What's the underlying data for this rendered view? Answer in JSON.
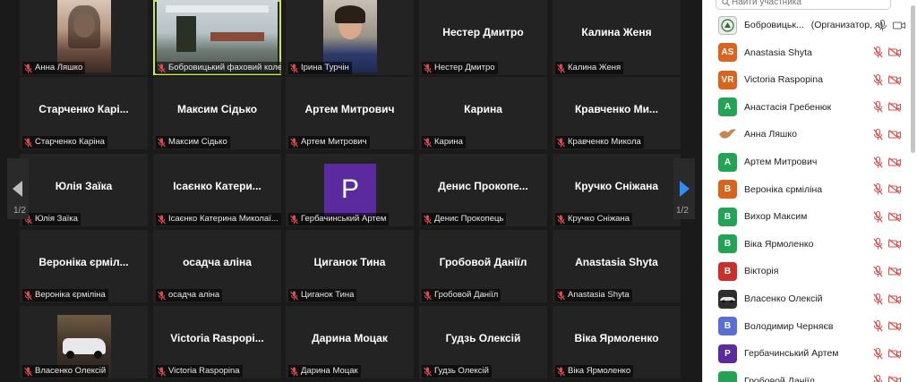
{
  "gallery": {
    "page_indicator": "1/2",
    "tiles": [
      {
        "label": "Анна Ляшко",
        "center": "",
        "kind": "photo-girl"
      },
      {
        "label": "Бобровицький фаховий коле...",
        "center": "",
        "kind": "photo-room",
        "active": true
      },
      {
        "label": "Ірина Турчін",
        "center": "",
        "kind": "photo-woman"
      },
      {
        "label": "Нестер Дмитро",
        "center": "Нестер Дмитро"
      },
      {
        "label": "Калина Женя",
        "center": "Калина Женя"
      },
      {
        "label": "Старченко Каріна",
        "center": "Старченко  Карі..."
      },
      {
        "label": "Максим Сідько",
        "center": "Максим Сідько"
      },
      {
        "label": "Артем Митрович",
        "center": "Артем Митрович"
      },
      {
        "label": "Карина",
        "center": "Карина"
      },
      {
        "label": "Кравченко Микола",
        "center": "Кравченко  Ми..."
      },
      {
        "label": "Юлія Заїка",
        "center": "Юлія Заїка"
      },
      {
        "label": "Ісаєнко Катерина Миколаї...",
        "center": "Ісаєнко  Катери..."
      },
      {
        "label": "Гербачинський Артем",
        "center": "",
        "kind": "avatar",
        "avatar_letter": "P"
      },
      {
        "label": "Денис Прокопець",
        "center": "Денис  Прокопе..."
      },
      {
        "label": "Кручко Сніжана",
        "center": "Кручко Сніжана"
      },
      {
        "label": "Вероніка єрміліна",
        "center": "Вероніка  єрміл..."
      },
      {
        "label": "осадча аліна",
        "center": "осадча аліна"
      },
      {
        "label": "Циганок Тина",
        "center": "Циганок Тина"
      },
      {
        "label": "Гробовой Даніїл",
        "center": "Гробовой Даніїл"
      },
      {
        "label": "Anastasia Shyta",
        "center": "Anastasia Shyta"
      },
      {
        "label": "Власенко Олексій",
        "center": "",
        "kind": "photo-car"
      },
      {
        "label": "Victoria Raspopina",
        "center": "Victoria  Raspopi..."
      },
      {
        "label": "Дарина Моцак",
        "center": "Дарина Моцак"
      },
      {
        "label": "Гудзь Олексій",
        "center": "Гудзь Олексій"
      },
      {
        "label": "Віка Ярмоленко",
        "center": "Віка Ярмоленко"
      }
    ]
  },
  "sidebar": {
    "search_placeholder": "Найти участника",
    "participants": [
      {
        "name": "Бобровицьк...",
        "suffix": "(Организатор, я)",
        "initials": "",
        "color": "#e8e8e8",
        "kind": "logo"
      },
      {
        "name": "Anastasia Shyta",
        "initials": "AS",
        "color": "#d9641e"
      },
      {
        "name": "Victoria Raspopina",
        "initials": "VR",
        "color": "#d9641e"
      },
      {
        "name": "Анастасія Гребенюк",
        "initials": "A",
        "color": "#23a455"
      },
      {
        "name": "Анна Ляшко",
        "initials": "",
        "color": "#ffffff",
        "kind": "bird"
      },
      {
        "name": "Артем Митрович",
        "initials": "A",
        "color": "#23a455"
      },
      {
        "name": "Вероніка єрміліна",
        "initials": "B",
        "color": "#d9641e"
      },
      {
        "name": "Вихор Максим",
        "initials": "B",
        "color": "#23a455"
      },
      {
        "name": "Віка Ярмоленко",
        "initials": "B",
        "color": "#23a455"
      },
      {
        "name": "Вікторія",
        "initials": "B",
        "color": "#c9302c"
      },
      {
        "name": "Власенко Олексій",
        "initials": "",
        "color": "#333333",
        "kind": "car"
      },
      {
        "name": "Володимир Черняєв",
        "initials": "B",
        "color": "#5a6fd6"
      },
      {
        "name": "Гербачинський Артем",
        "initials": "P",
        "color": "#5b2a9e"
      },
      {
        "name": "Гробовой Даніїл",
        "initials": "",
        "color": "#23a455"
      }
    ]
  }
}
